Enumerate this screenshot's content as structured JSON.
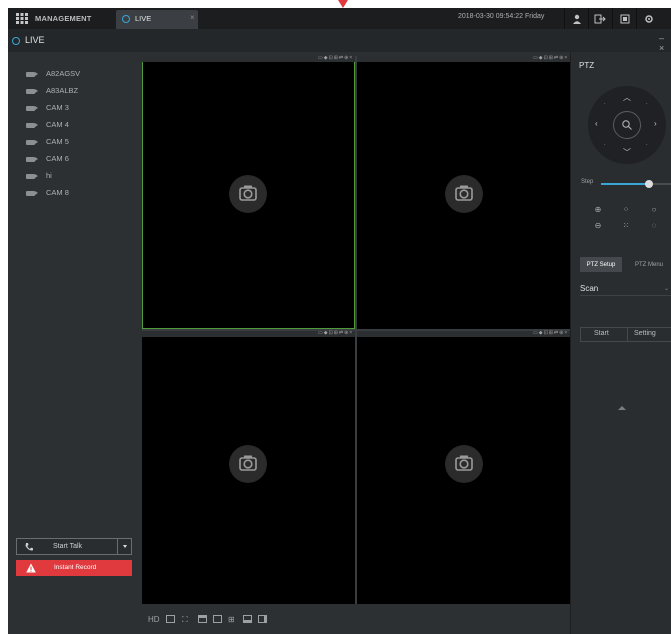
{
  "topbar": {
    "management_label": "MANAGEMENT",
    "live_tab_label": "LIVE",
    "close_glyph": "×",
    "datetime": "2018-03-30 09:54:22 Friday",
    "icons": [
      "user-icon",
      "logout-icon",
      "device-icon",
      "settings-icon"
    ]
  },
  "subbar": {
    "title": "LIVE",
    "minimize_glyph": "– ×"
  },
  "devices": [
    {
      "label": "A82AGSV"
    },
    {
      "label": "A83ALBZ"
    },
    {
      "label": "CAM 3"
    },
    {
      "label": "CAM 4"
    },
    {
      "label": "CAM 5"
    },
    {
      "label": "CAM 6"
    },
    {
      "label": "hi"
    },
    {
      "label": "CAM 8"
    }
  ],
  "talk": {
    "label": "Start Talk"
  },
  "record": {
    "label": "Instant Record",
    "color": "#e03a3e"
  },
  "video": {
    "tile_tools": "▭ ◆ ⊡ ⊞ ⇄ ⊕ ×",
    "active_color": "#4f9a3a"
  },
  "bottom_tools": {
    "hd_label": "HD",
    "icons": [
      "screen-icon",
      "fullscreen-icon",
      "single-split-icon",
      "single-view-icon",
      "quad-split-icon",
      "layout-icon",
      "layout-alt-icon"
    ]
  },
  "ptz": {
    "title": "PTZ",
    "step_label": "Step",
    "step_fraction": 0.68,
    "tab_setup": "PTZ Setup",
    "tab_menu": "PTZ Menu",
    "mode_value": "Scan",
    "start_label": "Start",
    "setting_label": "Setting",
    "accent": "#3aa6d8"
  }
}
